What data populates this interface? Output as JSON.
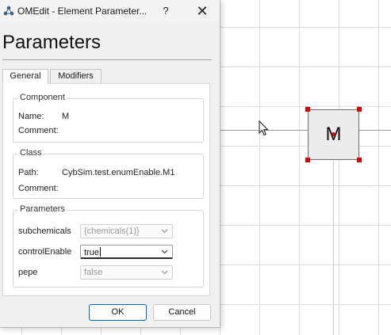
{
  "window": {
    "title": "OMEdit - Element Parameter...",
    "help_label": "?",
    "close_label": "✕"
  },
  "dialog": {
    "heading": "Parameters",
    "tabs": [
      {
        "label": "General",
        "active": true
      },
      {
        "label": "Modifiers",
        "active": false
      }
    ],
    "component": {
      "title": "Component",
      "name_label": "Name:",
      "name_value": "M",
      "comment_label": "Comment:",
      "comment_value": ""
    },
    "class": {
      "title": "Class",
      "path_label": "Path:",
      "path_value": "CybSim.test.enumEnable.M1",
      "comment_label": "Comment:",
      "comment_value": ""
    },
    "parameters": {
      "title": "Parameters",
      "rows": [
        {
          "label": "subchemicals",
          "value": "{chemicals(1)}",
          "enabled": false
        },
        {
          "label": "controlEnable",
          "value": "true",
          "enabled": true
        },
        {
          "label": "pepe",
          "value": "false",
          "enabled": false
        }
      ]
    },
    "buttons": {
      "ok": "OK",
      "cancel": "Cancel"
    }
  },
  "canvas": {
    "component_label": "M"
  },
  "colors": {
    "accent": "#0067c0",
    "selection_handle": "#e10000",
    "dialog_bg": "#f0f0f0"
  },
  "icons": [
    "app-icon",
    "help-icon",
    "close-icon",
    "chevron-down-icon",
    "mouse-cursor-icon"
  ]
}
